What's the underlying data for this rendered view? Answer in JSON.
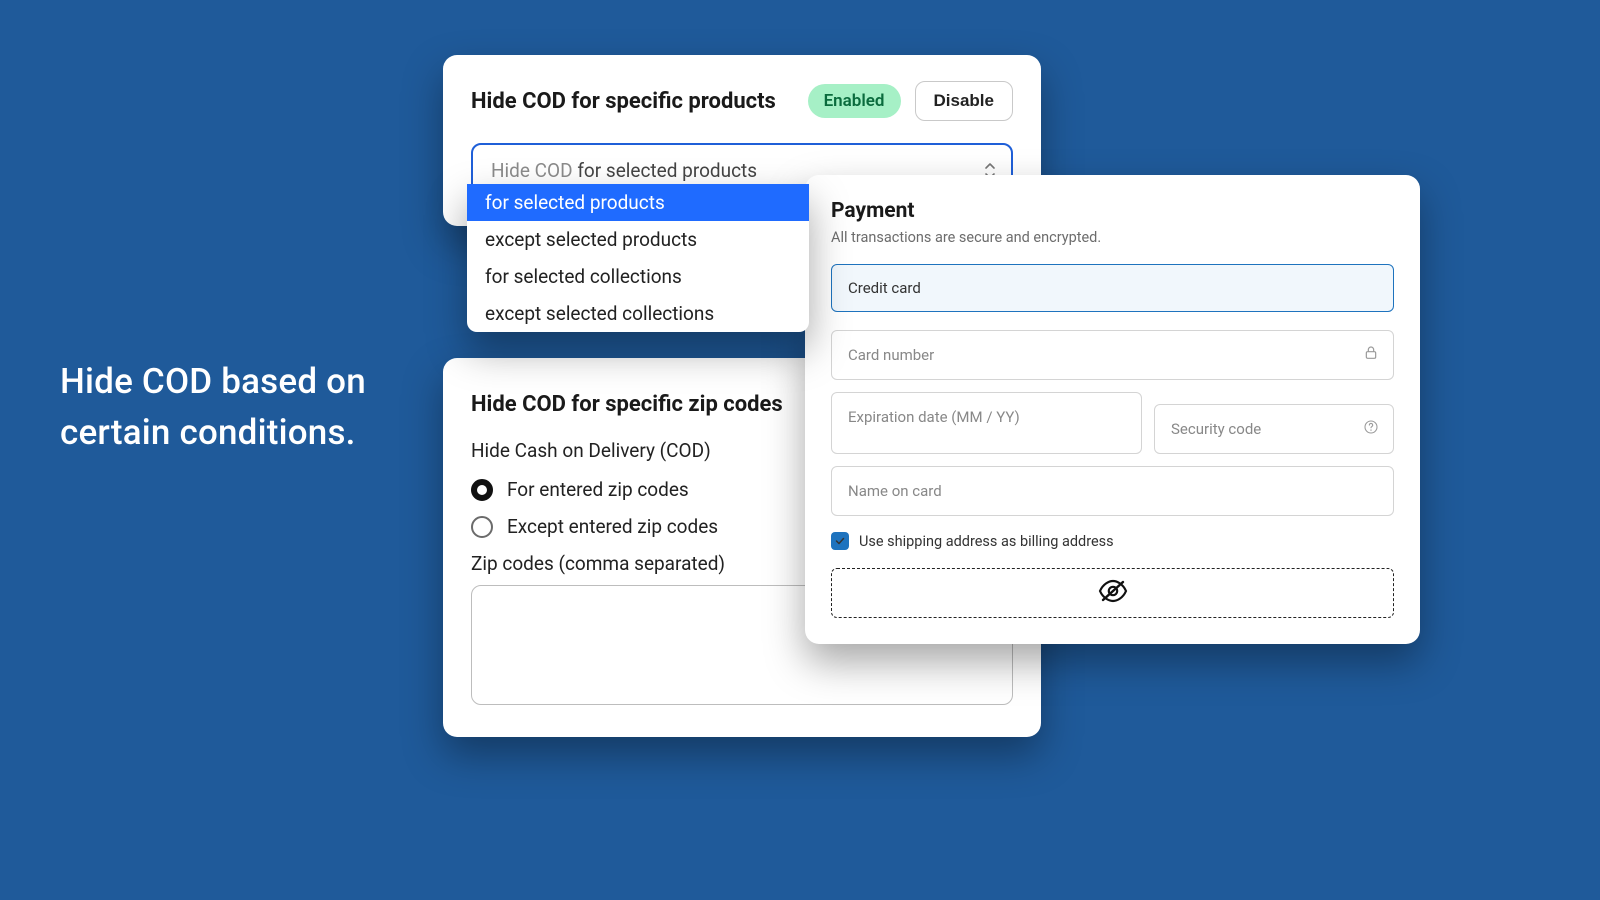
{
  "hero": {
    "line1": "Hide COD based on",
    "line2": "certain conditions."
  },
  "products_card": {
    "title": "Hide COD for specific products",
    "status_badge": "Enabled",
    "disable_button": "Disable",
    "select_prefix": "Hide COD ",
    "select_value": "for selected products",
    "options": {
      "0": "for selected products",
      "1": "except selected products",
      "2": "for selected collections",
      "3": "except selected collections"
    }
  },
  "zip_card": {
    "title": "Hide COD for specific zip codes",
    "subtitle": "Hide Cash on Delivery (COD)",
    "radio_for": "For entered zip codes",
    "radio_except": "Except entered zip codes",
    "zip_label": "Zip codes (comma separated)",
    "zip_value": ""
  },
  "payment_card": {
    "title": "Payment",
    "subtitle": "All transactions are secure and encrypted.",
    "method_label": "Credit card",
    "card_number_ph": "Card number",
    "exp_ph": "Expiration date (MM / YY)",
    "cvv_ph": "Security code",
    "name_ph": "Name on card",
    "billing_checkbox": "Use shipping address as billing address"
  }
}
